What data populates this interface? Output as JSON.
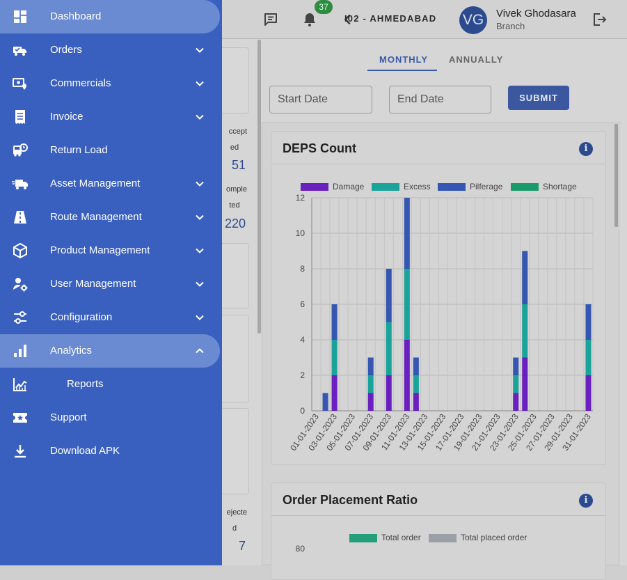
{
  "header": {
    "notification_count": "37",
    "branch": "I02 - AHMEDABAD",
    "avatar_initials": "VG",
    "user_name": "Vivek Ghodasara",
    "user_role": "Branch"
  },
  "stats_partial": [
    {
      "label_line1": "ccept",
      "label_line2": "ed",
      "value": "51"
    },
    {
      "label_line1": "omple",
      "label_line2": "ted",
      "value": "220"
    },
    {
      "label_line1": "ejecte",
      "label_line2": "d",
      "value": "7"
    }
  ],
  "tabs": [
    "MONTHLY",
    "ANNUALLY"
  ],
  "filters": {
    "start_placeholder": "Start Date",
    "end_placeholder": "End Date",
    "submit_label": "SUBMIT"
  },
  "sidebar": {
    "items": [
      {
        "label": "Dashboard",
        "icon": "dashboard-icon",
        "active": true
      },
      {
        "label": "Orders",
        "icon": "truck-check-icon",
        "chevron": "down"
      },
      {
        "label": "Commercials",
        "icon": "money-location-icon",
        "chevron": "down"
      },
      {
        "label": "Invoice",
        "icon": "receipt-icon",
        "chevron": "down"
      },
      {
        "label": "Return Load",
        "icon": "bus-clock-icon"
      },
      {
        "label": "Asset Management",
        "icon": "truck-fast-icon",
        "chevron": "down"
      },
      {
        "label": "Route Management",
        "icon": "road-icon",
        "chevron": "down"
      },
      {
        "label": "Product Management",
        "icon": "box-icon",
        "chevron": "down"
      },
      {
        "label": "User Management",
        "icon": "user-gear-icon",
        "chevron": "down"
      },
      {
        "label": "Configuration",
        "icon": "sliders-icon",
        "chevron": "down"
      },
      {
        "label": "Analytics",
        "icon": "bar-chart-icon",
        "chevron": "up",
        "active": true
      },
      {
        "label": "Reports",
        "icon": "line-chart-icon",
        "sub": true
      },
      {
        "label": "Support",
        "icon": "ticket-star-icon"
      },
      {
        "label": "Download APK",
        "icon": "download-icon"
      }
    ]
  },
  "cards": {
    "deps_title": "DEPS Count",
    "opr_title": "Order Placement Ratio",
    "opr_legend": [
      "Total order",
      "Total placed order"
    ],
    "opr_legend_colors": [
      "#23a07a",
      "#9aa0a6"
    ],
    "opr_ymax": "80"
  },
  "chart_data": {
    "type": "bar",
    "title": "DEPS Count",
    "stacked": true,
    "categories": [
      "01-01-2023",
      "02-01-2023",
      "03-01-2023",
      "04-01-2023",
      "05-01-2023",
      "06-01-2023",
      "07-01-2023",
      "08-01-2023",
      "09-01-2023",
      "10-01-2023",
      "11-01-2023",
      "12-01-2023",
      "13-01-2023",
      "14-01-2023",
      "15-01-2023",
      "16-01-2023",
      "17-01-2023",
      "18-01-2023",
      "19-01-2023",
      "20-01-2023",
      "21-01-2023",
      "22-01-2023",
      "23-01-2023",
      "24-01-2023",
      "25-01-2023",
      "26-01-2023",
      "27-01-2023",
      "28-01-2023",
      "29-01-2023",
      "30-01-2023",
      "31-01-2023"
    ],
    "series": [
      {
        "name": "Damage",
        "color": "#6a1fbf",
        "values": [
          0,
          0,
          2,
          0,
          0,
          0,
          1,
          0,
          2,
          0,
          4,
          1,
          0,
          0,
          0,
          0,
          0,
          0,
          0,
          0,
          0,
          0,
          1,
          3,
          0,
          0,
          0,
          0,
          0,
          0,
          2
        ]
      },
      {
        "name": "Excess",
        "color": "#1aa39a",
        "values": [
          0,
          0,
          2,
          0,
          0,
          0,
          1,
          0,
          3,
          0,
          4,
          1,
          0,
          0,
          0,
          0,
          0,
          0,
          0,
          0,
          0,
          0,
          1,
          3,
          0,
          0,
          0,
          0,
          0,
          0,
          2
        ]
      },
      {
        "name": "Pilferage",
        "color": "#3557b2",
        "values": [
          0,
          1,
          2,
          0,
          0,
          0,
          1,
          0,
          3,
          0,
          4,
          1,
          0,
          0,
          0,
          0,
          0,
          0,
          0,
          0,
          0,
          0,
          1,
          3,
          0,
          0,
          0,
          0,
          0,
          0,
          2
        ]
      },
      {
        "name": "Shortage",
        "color": "#1a9a6a",
        "values": [
          0,
          0,
          0,
          0,
          0,
          0,
          0,
          0,
          0,
          0,
          0,
          0,
          0,
          0,
          0,
          0,
          0,
          0,
          0,
          0,
          0,
          0,
          0,
          0,
          0,
          0,
          0,
          0,
          0,
          0,
          0
        ]
      }
    ],
    "ylim": [
      0,
      12
    ],
    "yticks": [
      0,
      2,
      4,
      6,
      8,
      10,
      12
    ],
    "xtick_labels": [
      "01-01-2023",
      "03-01-2023",
      "05-01-2023",
      "07-01-2023",
      "09-01-2023",
      "11-01-2023",
      "13-01-2023",
      "15-01-2023",
      "17-01-2023",
      "19-01-2023",
      "21-01-2023",
      "23-01-2023",
      "25-01-2023",
      "27-01-2023",
      "29-01-2023",
      "31-01-2023"
    ],
    "legend": "top",
    "grid": true
  }
}
